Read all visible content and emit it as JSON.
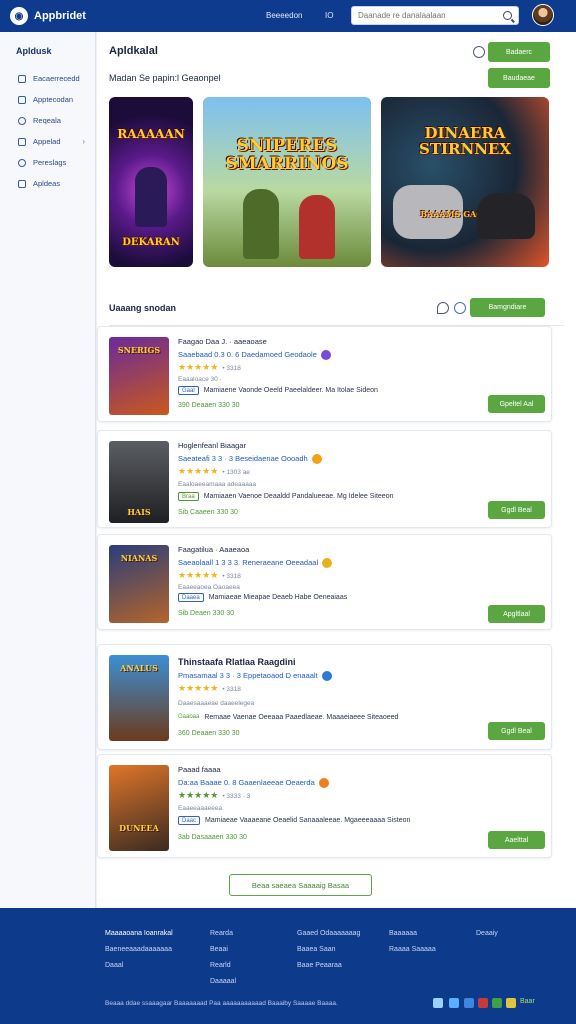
{
  "header": {
    "brand": "Appbridet",
    "links": [
      "Beeeedon",
      "IO"
    ],
    "search_placeholder": "Daanade re danalaalaan"
  },
  "sidebar": {
    "title": "Apldusk",
    "items": [
      {
        "label": "Eacaerrecedd"
      },
      {
        "label": "Apptecodan"
      },
      {
        "label": "Reqeala"
      },
      {
        "label": "Appelad"
      },
      {
        "label": "Pereslags"
      },
      {
        "label": "Apldeas"
      }
    ]
  },
  "main": {
    "title": "Apldkalal",
    "top_button": "Badaerc",
    "subtitle": "Madan Se papin:l Geaonpel",
    "sub_button": "Baudaeae",
    "featured": [
      {
        "title": "RAAAAAN",
        "subtitle": "DEKARAN"
      },
      {
        "title": "SNIPERES SMARRINOS"
      },
      {
        "title": "DINAERA STIRNNEX",
        "subtitle": "BAAAMS GAGKOUS"
      }
    ],
    "section": {
      "title": "Uaaang snodan",
      "button": "Bamgndiare"
    },
    "games": [
      {
        "thumb": "SNERIGS",
        "title": "Faagao Daa J. · aaeaoase",
        "developer": "Saaebaad 0.3 0. 6 Daedamoed Geodaole",
        "badge_color": "#7a4ad8",
        "stars": "★★★★★",
        "count": "• 3318",
        "meta": "Eaaaloace 30 ·",
        "tag": "Gaal",
        "desc": "Mamiaene Vaonde Oeeld Paeelaldeer. Ma Itolae Sideon",
        "price": "390 Deaaen 330 30",
        "button": "Gpeltel Aal"
      },
      {
        "thumb": "HAIS",
        "title": "Hoglenfeanl Biaagar",
        "developer": "Saeateafi 3 3 · 3  Beseidaenae Oooadh",
        "badge_color": "#f2a11b",
        "stars": "★★★★★",
        "count": "• 1303 ae",
        "meta": "Eaaloaeeamaaa adeaaaaa",
        "tag": "Braa",
        "desc": "Mamiaaen Vaenoe Deaaldd Pandalueeae. Mg Idelee Siteeon",
        "price": "Sib Caaeen 330 30",
        "button": "Ggdl Beal"
      },
      {
        "thumb": "NIANAS",
        "title": "Faagatilua · Aaaeaoa",
        "developer": "Saeaolaall 1 3 3 3. Reneraeane Oeeadaal",
        "badge_color": "#e8b21e",
        "stars": "★★★★★",
        "count": "• 3318",
        "meta": "Eaaeeaoea Oaoaeea",
        "tag": "Daaea",
        "desc": "Mamiaeae Mieapae Deaeb Habe Oeneaiaas",
        "price": "Sib Deaen 330 30",
        "button": "Apgltlaal"
      },
      {
        "thumb": "ANALUS",
        "title": "Thinstaafa Rlatlaa Raagdini",
        "developer": "Pmasamaal 3 3 · 3  Eppetaoaod D enaaalt",
        "badge_color": "#2e7ad8",
        "stars": "★★★★★",
        "count": "• 3318",
        "meta": "Daaesaaaeae daaeelegea",
        "tag": "Gaaoaa",
        "desc": "Remaae Vaenae Oeeaaa Paaedlaeae. Maaaeiaeee Siteaoeed",
        "price": "360 Deaaen 330 30",
        "button": "Ggdl Beal"
      },
      {
        "thumb": "DUNEEA",
        "title": "Paaad faaaa",
        "developer": "Da:aa Baaae 0. 8 Gaaenlaeeae Oeaerda",
        "badge_color": "#f07d1e",
        "stars": "★★★★★",
        "count": "• 3333 · 3",
        "meta": "Eaaeeaaaeeea",
        "tag": "Daac",
        "desc": "Mamiaeae Vaaaeane Oeaelid Sanaaaleeae. Mgaeeeaaaa Sisteon",
        "price": "3ab Dasaaaen 330 30",
        "button": "Aaelttal"
      }
    ],
    "load_more": "Beaa saeaea Saaaaig Basaa"
  },
  "footer": {
    "cols": [
      [
        "Maaaaoana Ioanrakal",
        "Baeneeaaadaaaaaaa",
        "Daaal"
      ],
      [
        "Rearda",
        "Beaai",
        "Rearld",
        "Daaaaal"
      ],
      [
        "Gaaed Odaaaaaaag",
        "Baaea Saan",
        "Baae Peaaraa"
      ],
      [
        "Baaaaaa",
        "Raaaa Saaaaa"
      ],
      [
        "Deaaiy"
      ]
    ],
    "copyright": "Beaaa ddae ssaaagaar Baaaaaaad Paa aaaaaaaaaaad Baaaiby Saaaae Baaaa.",
    "social_colors": [
      "#9bd0ff",
      "#5ab0ff",
      "#3f86e0",
      "#c43b3b",
      "#3fa04a",
      "#e0c53a"
    ],
    "social_last": "Baar"
  }
}
